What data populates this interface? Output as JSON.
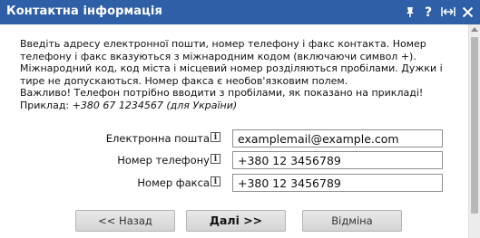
{
  "dialog": {
    "title": "Контактна інформація"
  },
  "description": {
    "lines": [
      "Введіть адресу електронної пошти, номер телефону і факс контакта. Номер",
      "телефону і факс вказуються з міжнародним кодом (включаючи символ +).",
      "Міжнародний код, код міста і місцевий номер розділяються пробілами. Дужки і",
      "тире не допускаються. Номер факса є необов'язковим полем.",
      "Важливо! Телефон потрібно вводити з пробілами, як показано на прикладі!"
    ],
    "example_label": "Приклад:",
    "example_value": "+380 67 1234567 (для України)"
  },
  "form": {
    "email": {
      "label": "Електронна пошта",
      "value": "examplemail@example.com"
    },
    "phone": {
      "label": "Номер телефону",
      "value": "+380 12 3456789"
    },
    "fax": {
      "label": "Номер факса",
      "value": "+380 12 3456789"
    }
  },
  "buttons": {
    "back": "<< Назад",
    "next": "Далі >>",
    "cancel": "Відміна"
  },
  "icons": {
    "title_icons": [
      "pin-icon",
      "help-icon",
      "resize-icon",
      "close-icon"
    ],
    "field_info": "info-icon"
  },
  "colors": {
    "titlebar": "#2f5fa7",
    "title_text": "#ffffff"
  }
}
